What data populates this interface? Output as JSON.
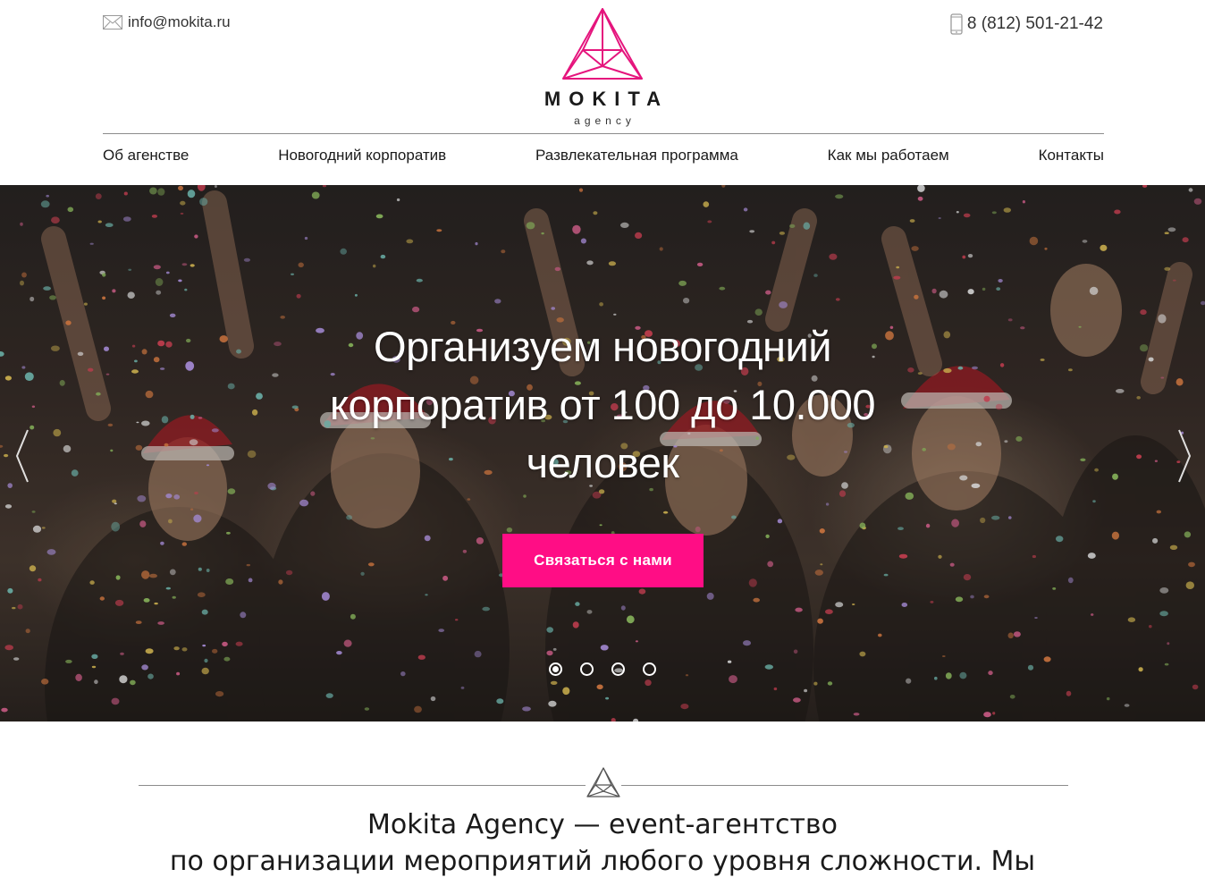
{
  "header": {
    "email": "info@mokita.ru",
    "phone": "8 (812) 501-21-42",
    "logo_name": "MOKITA",
    "logo_sub": "agency",
    "brand_color": "#e5157d"
  },
  "nav": {
    "items": [
      {
        "label": "Об агенстве"
      },
      {
        "label": "Новогодний корпоратив"
      },
      {
        "label": "Развлекательная программа"
      },
      {
        "label": "Как мы работаем"
      },
      {
        "label": "Контакты"
      }
    ]
  },
  "hero": {
    "title_line1": "Организуем новогодний",
    "title_line2": "корпоратив от 100 до 10.000",
    "title_line3": "человек",
    "cta_label": "Связаться с нами",
    "cta_color": "#ff0d85",
    "slides_total": 4,
    "active_slide": 1
  },
  "intro": {
    "line1": "Mokita Agency — event-агентство",
    "line2": "по организации мероприятий любого уровня сложности. Мы"
  }
}
